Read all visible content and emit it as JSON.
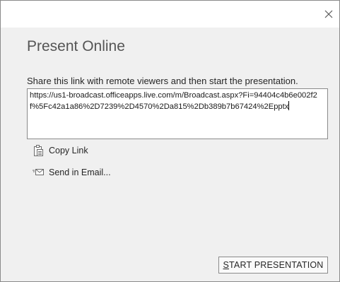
{
  "dialog": {
    "close_glyph": "×",
    "title": "Present Online",
    "instructions": "Share this link with remote viewers and then start the presentation.",
    "link": "https://us1-broadcast.officeapps.live.com/m/Broadcast.aspx?Fi=94404c4b6e002f2f%5Fc42a1a86%2D7239%2D4570%2Da815%2Db389b7b67424%2Epptx",
    "actions": [
      {
        "label": "Copy Link",
        "icon": "copy-icon"
      },
      {
        "label": "Send in Email...",
        "icon": "email-icon"
      }
    ],
    "start_button": {
      "accel": "S",
      "rest": "TART PRESENTATION"
    }
  }
}
